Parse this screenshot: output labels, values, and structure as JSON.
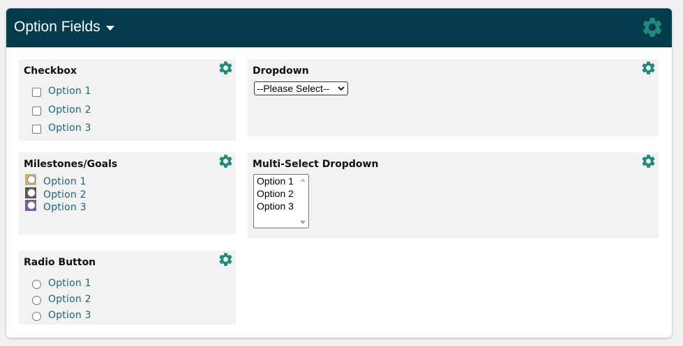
{
  "header": {
    "title": "Option Fields"
  },
  "colors": {
    "header_bg": "#043c4d",
    "accent_gear": "#1f8a7a",
    "option_text": "#1c6575",
    "milestone_colors": [
      "#c9b27a",
      "#555555",
      "#7a5a9a"
    ]
  },
  "checkbox": {
    "title": "Checkbox",
    "options": [
      "Option 1",
      "Option 2",
      "Option 3"
    ]
  },
  "dropdown": {
    "title": "Dropdown",
    "selected": "--Please Select--"
  },
  "milestones": {
    "title": "Milestones/Goals",
    "options": [
      "Option 1",
      "Option 2",
      "Option 3"
    ]
  },
  "multiselect": {
    "title": "Multi-Select Dropdown",
    "options": [
      "Option 1",
      "Option 2",
      "Option 3"
    ]
  },
  "radio": {
    "title": "Radio Button",
    "options": [
      "Option 1",
      "Option 2",
      "Option 3"
    ]
  },
  "icons": {
    "header_gear": "gear-icon",
    "panel_gear": "gear-icon",
    "title_caret": "caret-down-icon"
  }
}
